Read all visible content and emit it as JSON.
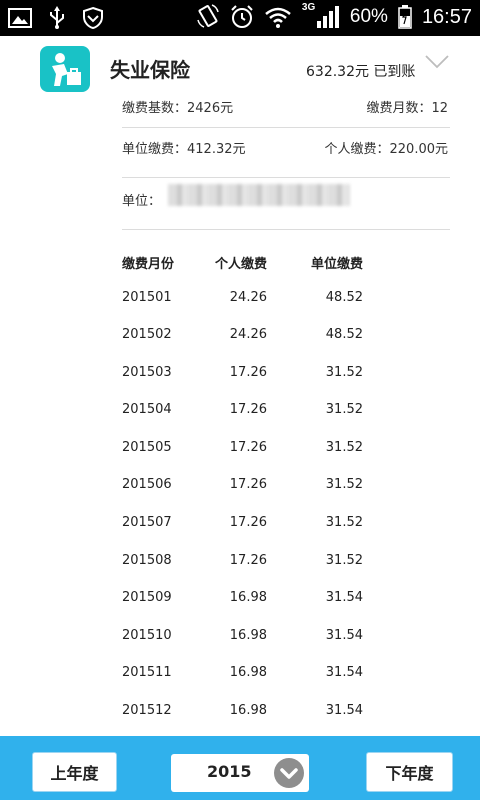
{
  "status_bar": {
    "network": "3G",
    "battery": "60%",
    "time": "16:57"
  },
  "header": {
    "title": "失业保险",
    "amount_status": "632.32元 已到账"
  },
  "summary": {
    "base_label": "缴费基数：2426元",
    "months_label": "缴费月数：12",
    "employer_total": "单位缴费：412.32元",
    "personal_total": "个人缴费：220.00元",
    "employer_name_label": "单位："
  },
  "table": {
    "headers": [
      "缴费月份",
      "个人缴费",
      "单位缴费"
    ],
    "rows": [
      {
        "month": "201501",
        "personal": "24.26",
        "employer": "48.52"
      },
      {
        "month": "201502",
        "personal": "24.26",
        "employer": "48.52"
      },
      {
        "month": "201503",
        "personal": "17.26",
        "employer": "31.52"
      },
      {
        "month": "201504",
        "personal": "17.26",
        "employer": "31.52"
      },
      {
        "month": "201505",
        "personal": "17.26",
        "employer": "31.52"
      },
      {
        "month": "201506",
        "personal": "17.26",
        "employer": "31.52"
      },
      {
        "month": "201507",
        "personal": "17.26",
        "employer": "31.52"
      },
      {
        "month": "201508",
        "personal": "17.26",
        "employer": "31.52"
      },
      {
        "month": "201509",
        "personal": "16.98",
        "employer": "31.54"
      },
      {
        "month": "201510",
        "personal": "16.98",
        "employer": "31.54"
      },
      {
        "month": "201511",
        "personal": "16.98",
        "employer": "31.54"
      },
      {
        "month": "201512",
        "personal": "16.98",
        "employer": "31.54"
      }
    ]
  },
  "footer": {
    "prev_year_label": "上年度",
    "year_value": "2015",
    "next_year_label": "下年度"
  },
  "colors": {
    "accent": "#30b1ec",
    "logo": "#19c2c6"
  },
  "icons": [
    "image-icon",
    "usb-icon",
    "shield-icon",
    "rotate-icon",
    "alarm-icon",
    "wifi-icon",
    "signal-icon",
    "battery-icon",
    "app-logo-icon",
    "chevron-down-icon"
  ]
}
